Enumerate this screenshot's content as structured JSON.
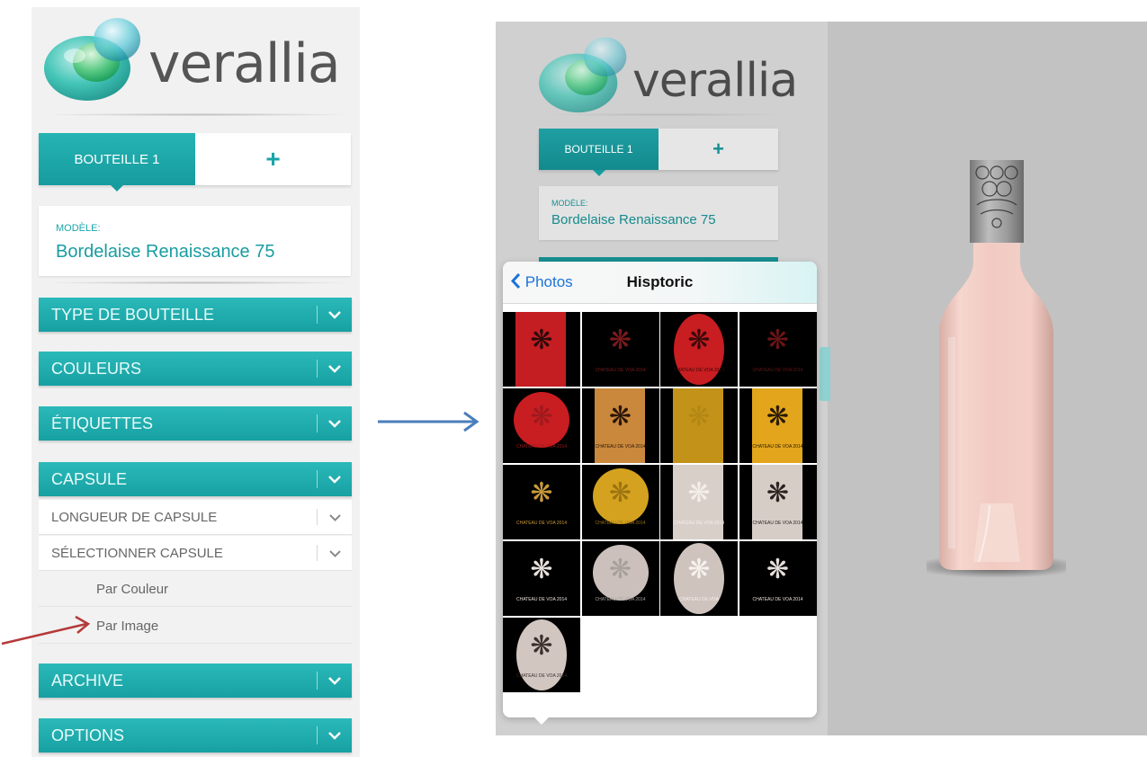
{
  "left": {
    "brand": "verallia",
    "tabs": {
      "active": "BOUTEILLE 1",
      "add": "+"
    },
    "model": {
      "label": "MODÈLE:",
      "value": "Bordelaise Renaissance 75"
    },
    "sections": [
      {
        "label": "TYPE DE BOUTEILLE"
      },
      {
        "label": "COULEURS"
      },
      {
        "label": "ÉTIQUETTES"
      },
      {
        "label": "CAPSULE"
      }
    ],
    "capsule_sub": [
      {
        "label": "LONGUEUR DE CAPSULE"
      },
      {
        "label": "SÉLECTIONNER CAPSULE"
      }
    ],
    "capsule_options": [
      {
        "label": "Par Couleur"
      },
      {
        "label": "Par Image"
      }
    ],
    "bottom_sections": [
      {
        "label": "ARCHIVE"
      },
      {
        "label": "OPTIONS"
      }
    ],
    "chevron": "⌄"
  },
  "right": {
    "brand": "verallia",
    "tabs": {
      "active": "BOUTEILLE 1",
      "add": "+"
    },
    "model": {
      "label": "MODÈLE:",
      "value": "Bordelaise Renaissance 75"
    },
    "picker": {
      "back_label": "Photos",
      "title": "Hisptoric",
      "thumbnails": [
        {
          "bg": "#c41e22",
          "ornament": "#2a0a0a",
          "shape": "rect",
          "caption": "",
          "frame": "#000"
        },
        {
          "bg": "#000000",
          "ornament": "#7a1a1d",
          "shape": "none",
          "caption": "CHATEAU DE VOA 2014",
          "frame": "#000"
        },
        {
          "bg": "#c81d21",
          "ornament": "#3a0a0a",
          "shape": "oval",
          "caption": "CHATEAU DE VOA 2014",
          "frame": "#000"
        },
        {
          "bg": "#000000",
          "ornament": "#6a1416",
          "shape": "none",
          "caption": "CHATEAU DE VOA 2014",
          "frame": "#000"
        },
        {
          "bg": "#c81d21",
          "ornament": "#9d1a1d",
          "shape": "circle",
          "caption": "CHATEAU DE VOA 2014",
          "frame": "#000"
        },
        {
          "bg": "#c9883c",
          "ornament": "#2a1608",
          "shape": "rect",
          "caption": "CHATEAU DE VOA 2014",
          "frame": "#000"
        },
        {
          "bg": "#c39319",
          "ornament": "#b38714",
          "shape": "rect",
          "caption": "",
          "frame": "#000"
        },
        {
          "bg": "#e2a51c",
          "ornament": "#2a1a04",
          "shape": "rect",
          "caption": "CHATEAU DE VOA 2014",
          "frame": "#000"
        },
        {
          "bg": "#000000",
          "ornament": "#c99a3a",
          "shape": "none",
          "caption": "CHATEAU DE VOA 2014",
          "frame": "#000"
        },
        {
          "bg": "#d4a21f",
          "ornament": "#9c7310",
          "shape": "circle",
          "caption": "CHATEAU DE VOA 2014",
          "frame": "#000"
        },
        {
          "bg": "#d9cfc9",
          "ornament": "#f3eeea",
          "shape": "rect",
          "caption": "CHATEAU DE VOA 2014",
          "frame": "#000"
        },
        {
          "bg": "#d7cdc7",
          "ornament": "#2b2320",
          "shape": "rect",
          "caption": "CHATEAU DE VOA 2014",
          "frame": "#000"
        },
        {
          "bg": "#000000",
          "ornament": "#e8e1dc",
          "shape": "none",
          "caption": "CHATEAU DE VOA 2014",
          "frame": "#000"
        },
        {
          "bg": "#cbc0bb",
          "ornament": "#a8a09c",
          "shape": "circle",
          "caption": "CHATEAU DE VOA 2014",
          "frame": "#000"
        },
        {
          "bg": "#cfc3bd",
          "ornament": "#f6f1ee",
          "shape": "oval",
          "caption": "CHATEAU DE VOA",
          "frame": "#000"
        },
        {
          "bg": "#000000",
          "ornament": "#e6dfda",
          "shape": "none",
          "caption": "CHATEAU DE VOA 2014",
          "frame": "#000"
        },
        {
          "bg": "#d2c6c1",
          "ornament": "#3a302c",
          "shape": "oval",
          "caption": "CHATEAU DE VOA 2014",
          "frame": "#000"
        }
      ]
    }
  },
  "colors": {
    "accent": "#1aa5a8",
    "bottle": "#f3cfc7",
    "capsule": "#9b9b9b",
    "annotation_blue": "#4a7ebb",
    "annotation_red": "#b53a3a"
  }
}
